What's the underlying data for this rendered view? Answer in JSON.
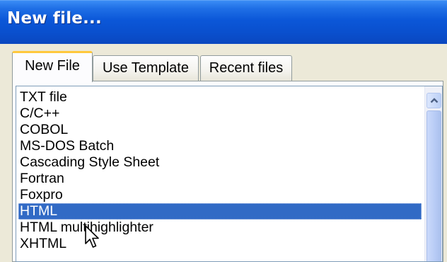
{
  "window": {
    "title": "New file..."
  },
  "tabs": [
    {
      "label": "New File",
      "active": true
    },
    {
      "label": "Use Template",
      "active": false
    },
    {
      "label": "Recent files",
      "active": false
    }
  ],
  "file_types": [
    "TXT file",
    "C/C++",
    "COBOL",
    "MS-DOS Batch",
    "Cascading Style Sheet",
    "Fortran",
    "Foxpro",
    "HTML",
    "HTML multihighlighter",
    "XHTML"
  ],
  "selected_item": "HTML",
  "colors": {
    "titlebar": "#0a4fcd",
    "selection": "#316ac5",
    "active_tab_accent": "#ffc83c"
  },
  "icons": {
    "scroll_up": "chevron-up-icon",
    "pointer": "mouse-pointer-icon"
  }
}
